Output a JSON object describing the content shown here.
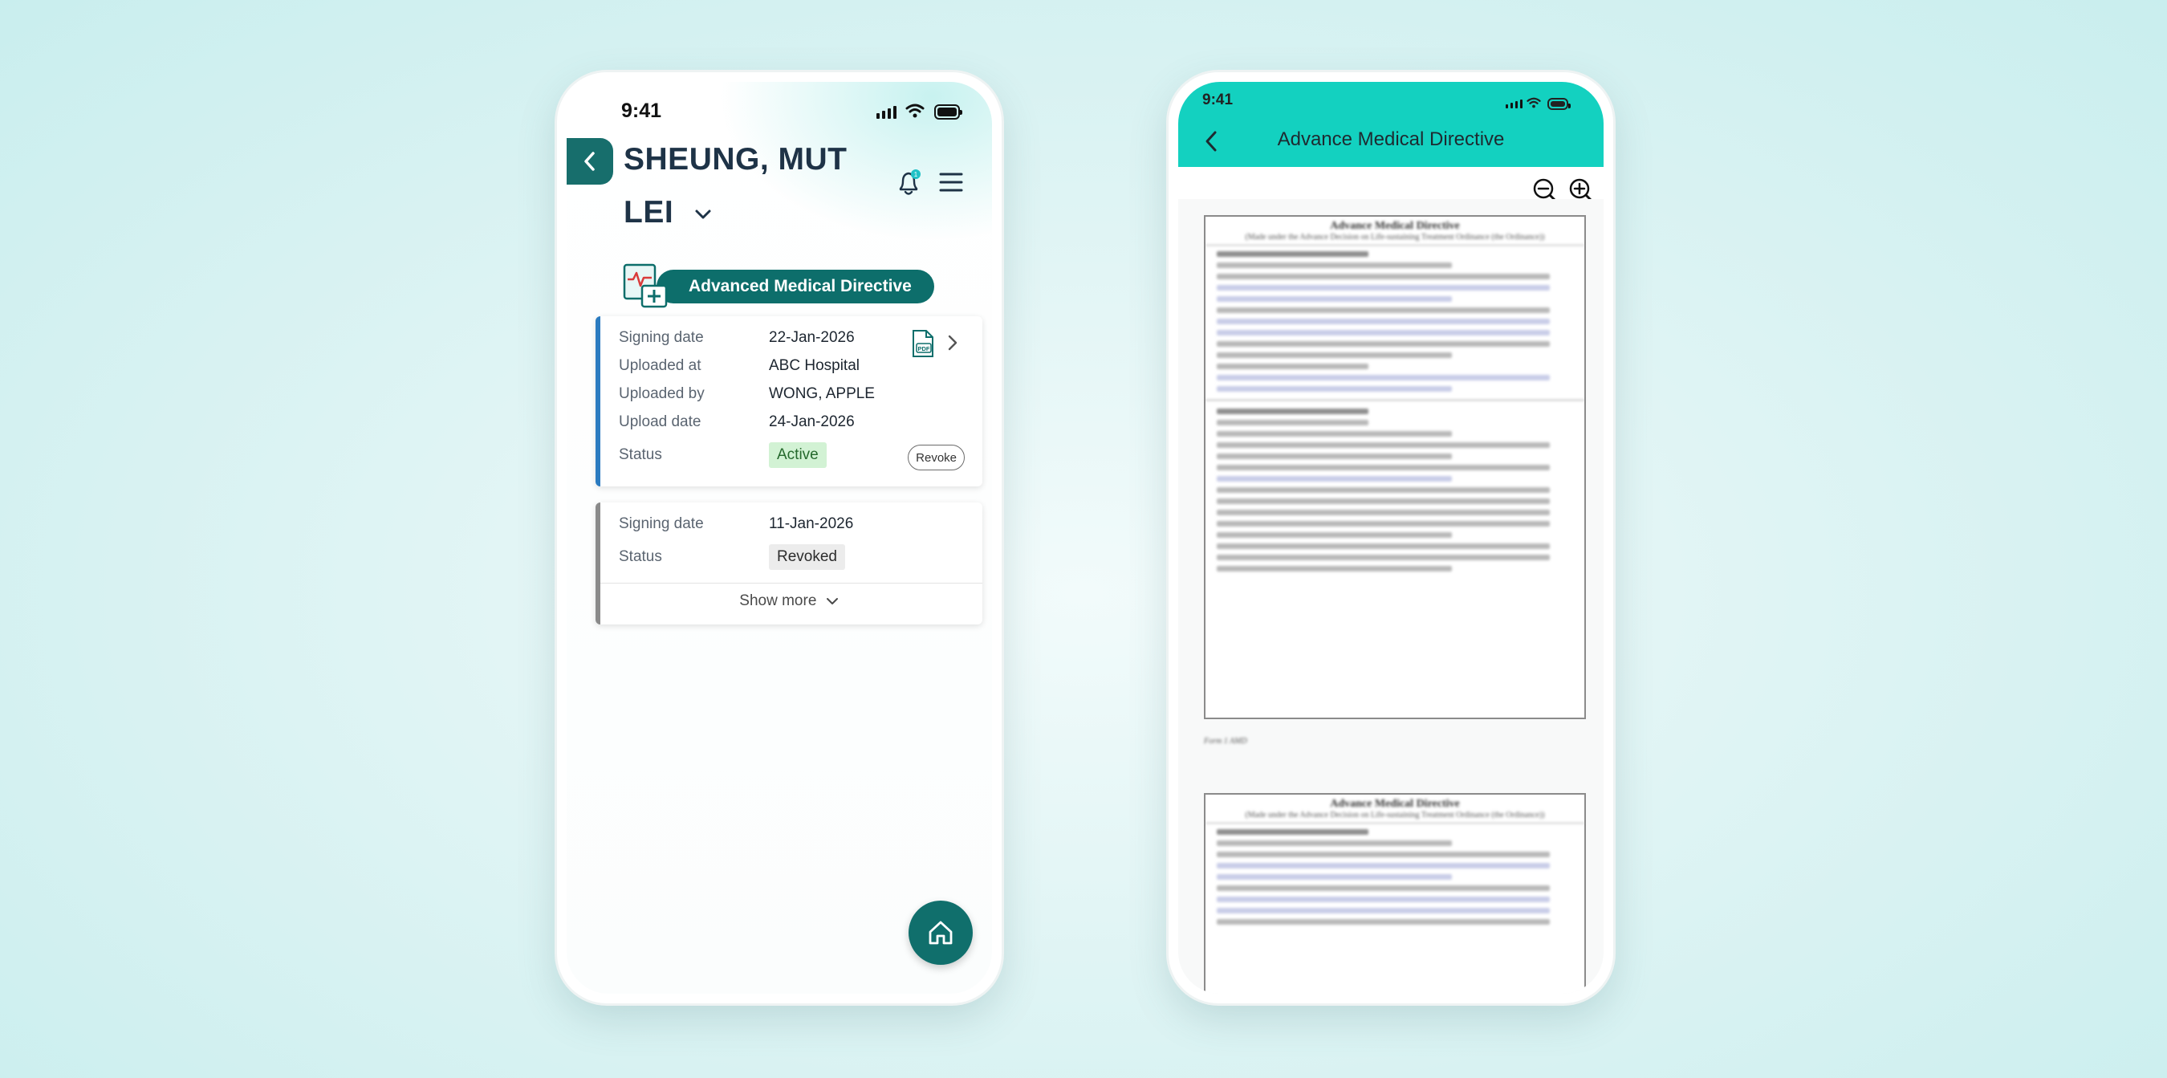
{
  "left_screen": {
    "status_bar": {
      "time": "9:41"
    },
    "header": {
      "patient_name": "SHEUNG, MUT LEI",
      "name_line_1": "SHEUNG, MUT",
      "name_line_2": "LEI",
      "notification_count": "1"
    },
    "section": {
      "title": "Advanced Medical Directive"
    },
    "records": [
      {
        "signing_date_label": "Signing date",
        "signing_date": "22-Jan-2026",
        "uploaded_at_label": "Uploaded at",
        "uploaded_at": "ABC Hospital",
        "uploaded_by_label": "Uploaded by",
        "uploaded_by": "WONG, APPLE",
        "upload_date_label": "Upload date",
        "upload_date": "24-Jan-2026",
        "status_label": "Status",
        "status": "Active",
        "revoke_label": "Revoke",
        "file_icon_label": "PDF"
      },
      {
        "signing_date_label": "Signing date",
        "signing_date": "11-Jan-2026",
        "status_label": "Status",
        "status": "Revoked",
        "show_more_label": "Show more"
      }
    ],
    "colors": {
      "primary": "#0d6e6b",
      "active_stripe": "#2b7bc0",
      "revoked_stripe": "#8a8a8a"
    }
  },
  "right_screen": {
    "status_bar": {
      "time": "9:41"
    },
    "header": {
      "title": "Advance Medical Directive"
    },
    "document": {
      "page_title": "Advance Medical Directive",
      "page_subtitle": "(Made under the Advance Decision on Life-sustaining Treatment Ordinance (the Ordinance))",
      "footer_note": "Form 1 AMD"
    },
    "colors": {
      "header_bg": "#13d1c0"
    }
  }
}
